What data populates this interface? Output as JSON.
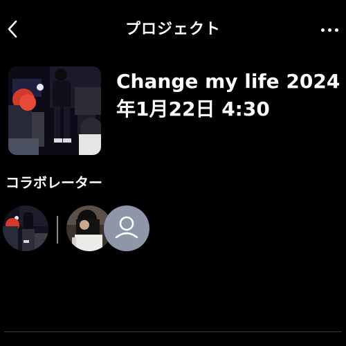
{
  "header": {
    "title": "プロジェクト",
    "back_icon": "chevron-left-icon",
    "more_icon": "more-horizontal-icon"
  },
  "project": {
    "title_line1": "Change my life 2024",
    "title_line2": "年1月22日 4:30",
    "cover_image": "concert-crowd-photo"
  },
  "collaborators": {
    "section_title": "コラボレーター",
    "items": [
      {
        "type": "photo",
        "image": "concert-crowd-photo"
      },
      {
        "type": "photo",
        "image": "person-dark-hair-photo"
      },
      {
        "type": "placeholder",
        "icon": "person-icon"
      }
    ]
  },
  "colors": {
    "background": "#000000",
    "text": "#ffffff",
    "placeholder_avatar": "#8e96a8",
    "divider": "#8a8a8a"
  }
}
